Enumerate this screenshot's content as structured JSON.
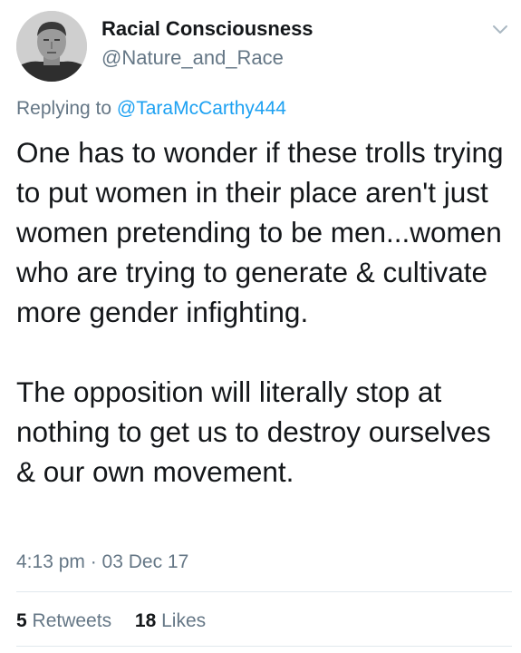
{
  "author": {
    "display_name": "Racial Consciousness",
    "handle": "@Nature_and_Race",
    "avatar_icon": "profile-photo"
  },
  "reply": {
    "prefix": "Replying to",
    "target": "@TaraMcCarthy444"
  },
  "body": {
    "paragraph_1": "One has to wonder if these trolls trying to put women in their place aren't just women pretending to be men...women who are trying to generate & cultivate more gender infighting.",
    "paragraph_2": "The opposition will literally stop at nothing to get us to destroy ourselves & our own movement."
  },
  "timestamp": "4:13 pm · 03 Dec 17",
  "stats": {
    "retweets_count": "5",
    "retweets_label": "Retweets",
    "likes_count": "18",
    "likes_label": "Likes"
  },
  "colors": {
    "text": "#14171a",
    "secondary": "#657786",
    "link": "#1da1f2",
    "divider": "#e1e8ed"
  },
  "menu_icon": "chevron-down-icon"
}
